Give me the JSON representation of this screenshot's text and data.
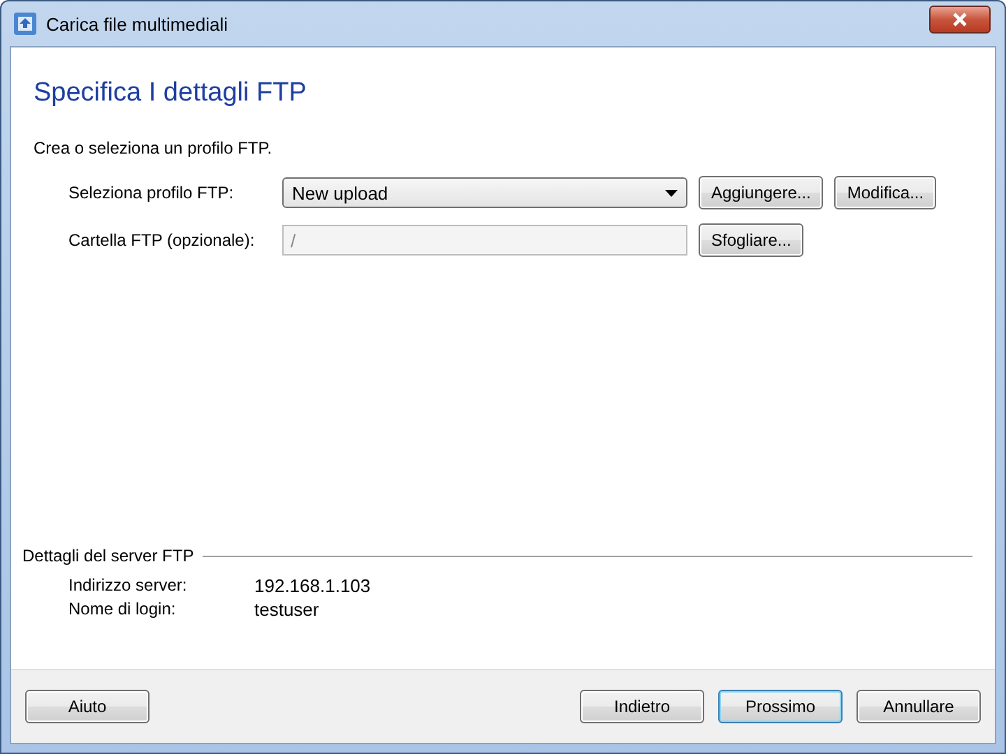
{
  "window": {
    "title": "Carica file multimediali"
  },
  "heading": "Specifica I dettagli FTP",
  "instruction": "Crea o seleziona un profilo FTP.",
  "fields": [
    {
      "kind": "dropdown",
      "label": "Seleziona profilo FTP:",
      "value": "New upload",
      "disabled": false,
      "buttons": [
        "Aggiungere...",
        "Modifica..."
      ]
    },
    {
      "kind": "text",
      "label": "Cartella FTP (opzionale):",
      "value": "/",
      "disabled": true,
      "buttons": [
        "Sfogliare..."
      ]
    }
  ],
  "server_details": {
    "title": "Dettagli del server FTP",
    "rows": [
      {
        "label": "Indirizzo server:",
        "value": "192.168.1.103"
      },
      {
        "label": "Nome di login:",
        "value": "testuser"
      }
    ]
  },
  "footer": {
    "left": [
      {
        "label": "Aiuto",
        "default": false
      }
    ],
    "right": [
      {
        "label": "Indietro",
        "default": false
      },
      {
        "label": "Prossimo",
        "default": true
      },
      {
        "label": "Annullare",
        "default": false
      }
    ]
  }
}
